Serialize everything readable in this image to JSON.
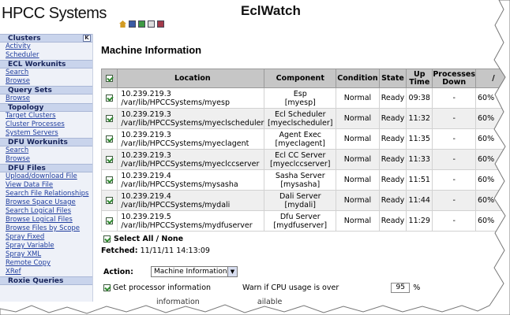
{
  "header": {
    "logo": "HPCC Systems",
    "app_title": "EclWatch",
    "toolbar_icons": [
      "home-icon",
      "print-icon",
      "save-icon",
      "edit-icon",
      "close-icon"
    ]
  },
  "sidebar": {
    "sections": [
      {
        "title": "Clusters",
        "links": [
          "Activity",
          "Scheduler"
        ]
      },
      {
        "title": "ECL Workunits",
        "links": [
          "Search",
          "Browse"
        ]
      },
      {
        "title": "Query Sets",
        "links": [
          "Browse"
        ]
      },
      {
        "title": "Topology",
        "links": [
          "Target Clusters",
          "Cluster Processes",
          "System Servers"
        ]
      },
      {
        "title": "DFU Workunits",
        "links": [
          "Search",
          "Browse"
        ]
      },
      {
        "title": "DFU Files",
        "links": [
          "Upload/download File",
          "View Data File",
          "Search File Relationships",
          "Browse Space Usage",
          "Search Logical Files",
          "Browse Logical Files",
          "Browse Files by Scope",
          "Spray Fixed",
          "Spray Variable",
          "Spray XML",
          "Remote Copy",
          "XRef"
        ]
      },
      {
        "title": "Roxie Queries",
        "links": []
      }
    ]
  },
  "main": {
    "title": "Machine Information",
    "columns": [
      "Location",
      "Component",
      "Condition",
      "State",
      "Up Time",
      "Processes Down",
      "/"
    ],
    "rows": [
      {
        "ip": "10.239.219.3",
        "path": "/var/lib/HPCCSystems/myesp",
        "comp": "Esp",
        "comp_id": "[myesp]",
        "condition": "Normal",
        "state": "Ready",
        "uptime": "09:38",
        "down": "-",
        "extra": "60%"
      },
      {
        "ip": "10.239.219.3",
        "path": "/var/lib/HPCCSystems/myeclscheduler",
        "comp": "Ecl Scheduler",
        "comp_id": "[myeclscheduler]",
        "condition": "Normal",
        "state": "Ready",
        "uptime": "11:32",
        "down": "-",
        "extra": "60%"
      },
      {
        "ip": "10.239.219.3",
        "path": "/var/lib/HPCCSystems/myeclagent",
        "comp": "Agent Exec",
        "comp_id": "[myeclagent]",
        "condition": "Normal",
        "state": "Ready",
        "uptime": "11:35",
        "down": "-",
        "extra": "60%"
      },
      {
        "ip": "10.239.219.3",
        "path": "/var/lib/HPCCSystems/myeclccserver",
        "comp": "Ecl CC Server",
        "comp_id": "[myeclccserver]",
        "condition": "Normal",
        "state": "Ready",
        "uptime": "11:33",
        "down": "-",
        "extra": "60%"
      },
      {
        "ip": "10.239.219.4",
        "path": "/var/lib/HPCCSystems/mysasha",
        "comp": "Sasha Server",
        "comp_id": "[mysasha]",
        "condition": "Normal",
        "state": "Ready",
        "uptime": "11:51",
        "down": "-",
        "extra": "60%"
      },
      {
        "ip": "10.239.219.4",
        "path": "/var/lib/HPCCSystems/mydali",
        "comp": "Dali Server",
        "comp_id": "[mydali]",
        "condition": "Normal",
        "state": "Ready",
        "uptime": "11:44",
        "down": "-",
        "extra": "60%"
      },
      {
        "ip": "10.239.219.5",
        "path": "/var/lib/HPCCSystems/mydfuserver",
        "comp": "Dfu Server",
        "comp_id": "[mydfuserver]",
        "condition": "Normal",
        "state": "Ready",
        "uptime": "11:29",
        "down": "-",
        "extra": "60%"
      }
    ],
    "select_all": "Select All / None",
    "fetched_label": "Fetched:",
    "fetched_value": "11/11/11 14:13:09",
    "action_label": "Action:",
    "action_value": "Machine Information",
    "get_processor": "Get processor information",
    "warn_cpu": "Warn if CPU usage is over",
    "warn_value": "95",
    "warn_unit": "%",
    "cut_text": "information",
    "cut_text2": "ailable"
  },
  "colors": {
    "sidebar_bg": "#eef1f8",
    "sidebar_head": "#c9d4ec",
    "link": "#1f3d9e",
    "table_head": "#c6c6c6"
  }
}
